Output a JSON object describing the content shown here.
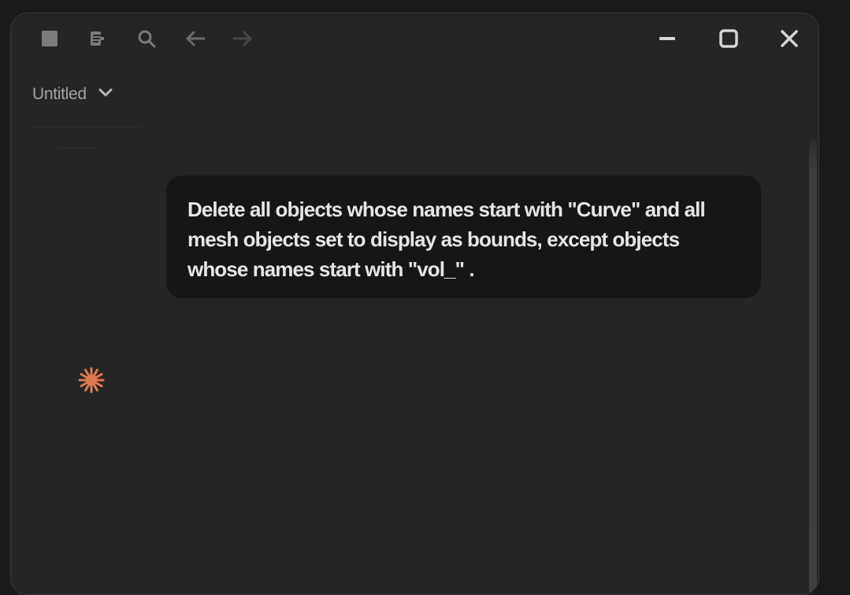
{
  "window": {
    "controls": {
      "minimize_icon": "minimize-icon",
      "maximize_icon": "maximize-icon",
      "close_icon": "close-icon"
    }
  },
  "toolbar": {
    "icons": [
      "sidebar-toggle-icon",
      "new-chat-icon",
      "search-icon",
      "back-arrow-icon",
      "forward-arrow-icon"
    ]
  },
  "conversation": {
    "title": "Untitled",
    "title_dropdown_icon": "chevron-down-icon"
  },
  "messages": [
    {
      "role": "user",
      "text": "Delete all objects whose names start with \"Curve\" and all mesh objects set to display as bounds, except objects whose names start with \"vol_\" ."
    }
  ],
  "status": {
    "thinking_indicator_icon": "thinking-spinner-icon",
    "accent_color": "#e07a52"
  },
  "colors": {
    "window_bg": "#252525",
    "bubble_bg": "#161616",
    "text": "#e6e6e6",
    "muted_text": "#a3a3a3"
  }
}
